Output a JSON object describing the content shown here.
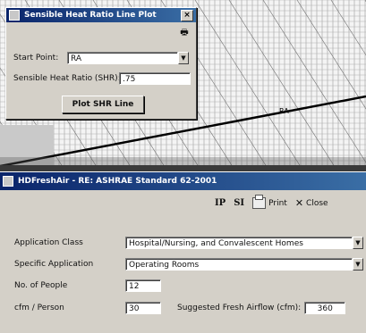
{
  "shr_dialog": {
    "title": "Sensible Heat Ratio Line Plot",
    "close_glyph": "×",
    "print_icon_glyph": "🖶",
    "start_point_label": "Start Point:",
    "start_point_value": "RA",
    "shr_label": "Sensible Heat Ratio (SHR):",
    "shr_value": ".75",
    "plot_button": "Plot SHR Line"
  },
  "chart": {
    "point_label": "RA"
  },
  "hd_window": {
    "title": "HDFreshAir - RE: ASHRAE Standard 62-2001",
    "toolbar": {
      "ip": "IP",
      "si": "SI",
      "print": "Print",
      "close": "Close",
      "close_glyph": "✕"
    },
    "application_class_label": "Application Class",
    "application_class_value": "Hospital/Nursing, and Convalescent Homes",
    "specific_application_label": "Specific Application",
    "specific_application_value": "Operating Rooms",
    "num_people_label": "No. of People",
    "num_people_value": "12",
    "cfm_person_label": "cfm / Person",
    "cfm_person_value": "30",
    "suggested_airflow_label": "Suggested Fresh Airflow (cfm):",
    "suggested_airflow_value": "360",
    "dropdown_glyph": "▼"
  }
}
